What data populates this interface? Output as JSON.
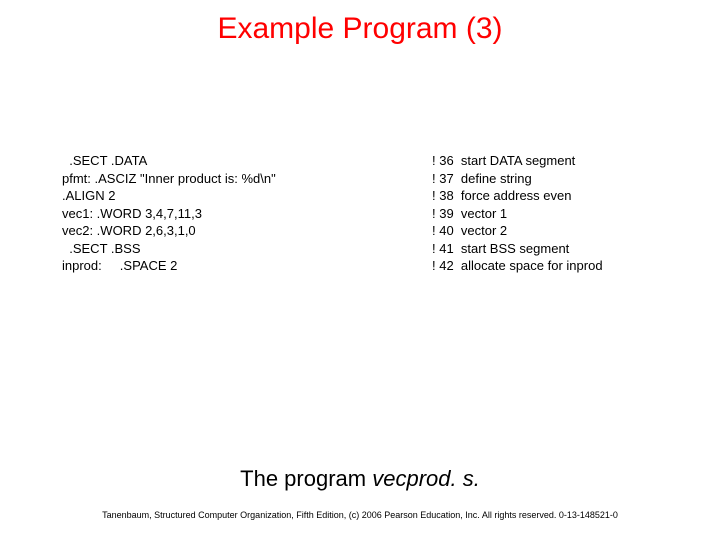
{
  "title": "Example Program (3)",
  "code": {
    "rows": [
      {
        "left": "  .SECT .DATA",
        "right": "! 36  start DATA segment"
      },
      {
        "left": "pfmt: .ASCIZ \"Inner product is: %d\\n\"",
        "right": "! 37  define string"
      },
      {
        "left": ".ALIGN 2",
        "right": "! 38  force address even"
      },
      {
        "left": "vec1: .WORD 3,4,7,11,3",
        "right": "! 39  vector 1"
      },
      {
        "left": "vec2: .WORD 2,6,3,1,0",
        "right": "! 40  vector 2"
      },
      {
        "left": "  .SECT .BSS",
        "right": "! 41  start BSS segment"
      },
      {
        "left": "inprod:     .SPACE 2",
        "right": "! 42  allocate space for inprod"
      }
    ]
  },
  "caption_prefix": "The program ",
  "caption_ital": "vecprod. s.",
  "footer": "Tanenbaum, Structured Computer Organization, Fifth Edition, (c) 2006 Pearson Education, Inc. All rights reserved. 0-13-148521-0"
}
